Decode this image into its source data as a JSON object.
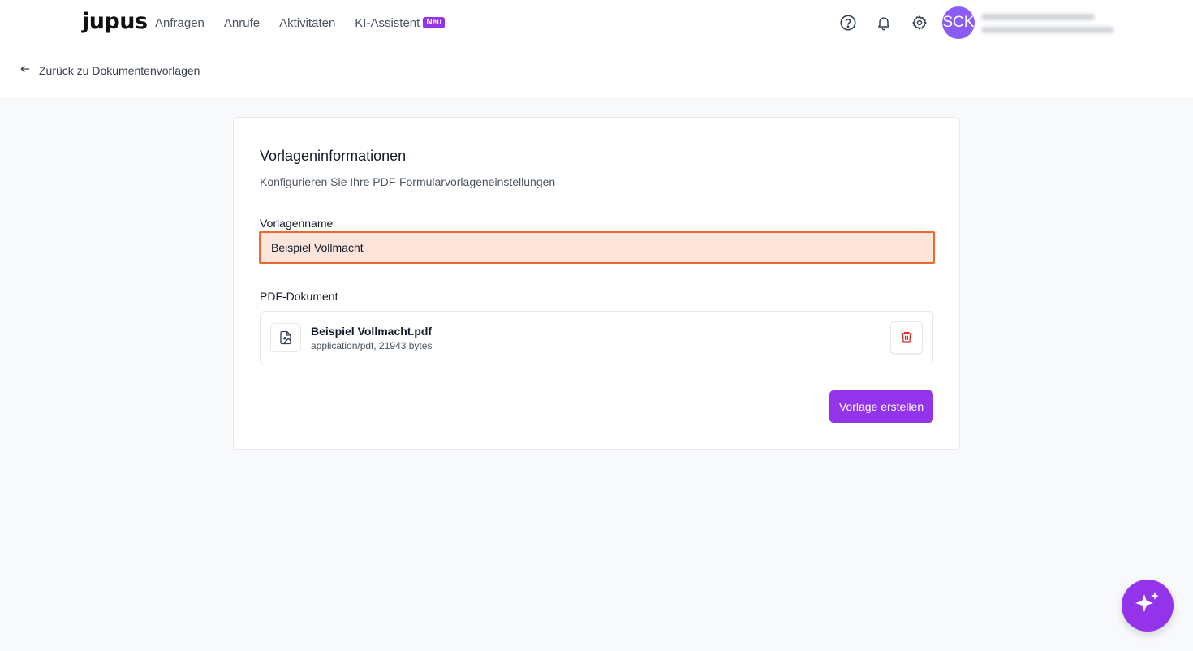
{
  "header": {
    "logo": "jupus",
    "nav": [
      {
        "label": "Anfragen"
      },
      {
        "label": "Anrufe"
      },
      {
        "label": "Aktivitäten"
      },
      {
        "label": "KI-Assistent",
        "badge": "Neu"
      }
    ],
    "icons": [
      "help-icon",
      "bell-icon",
      "gear-icon"
    ],
    "avatar_initials": "SCK"
  },
  "subheader": {
    "back_label": "Zurück zu Dokumentenvorlagen"
  },
  "card": {
    "title": "Vorlageninformationen",
    "subtitle": "Konfigurieren Sie Ihre PDF-Formularvorlageneinstellungen",
    "name_label": "Vorlagenname",
    "name_value": "Beispiel Vollmacht",
    "pdf_label": "PDF-Dokument",
    "file": {
      "name": "Beispiel Vollmacht.pdf",
      "meta": "application/pdf, 21943 bytes"
    },
    "submit_label": "Vorlage erstellen"
  },
  "colors": {
    "accent": "#9333ea",
    "avatar": "#8b5cf6",
    "input_error_border": "#ea6a2f",
    "input_error_bg": "#fde5dc",
    "delete": "#dc2626"
  }
}
